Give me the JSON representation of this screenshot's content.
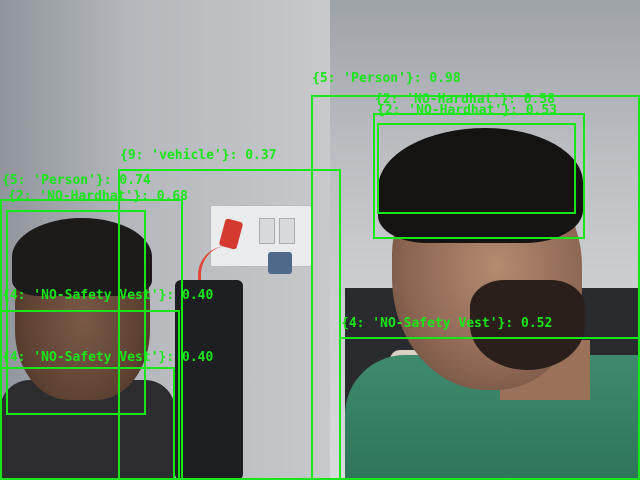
{
  "detections": [
    {
      "label": "{5: 'Person'}: 0.98"
    },
    {
      "label": "{2: 'NO-Hardhat'}: 0.58"
    },
    {
      "label": "{2: 'NO-Hardhat'}: 0.53"
    },
    {
      "label": "{9: 'vehicle'}: 0.37"
    },
    {
      "label": "{5: 'Person'}: 0.74"
    },
    {
      "label": "{2: 'NO-Hardhat'}: 0.68"
    },
    {
      "label": "{4: 'NO-Safety Vest'}: 0.52"
    },
    {
      "label": "{4: 'NO-Safety Vest'}: 0.40"
    },
    {
      "label": "{4: 'NO-Safety Vest'}: 0.40"
    }
  ],
  "colors": {
    "box": "#19e619"
  }
}
